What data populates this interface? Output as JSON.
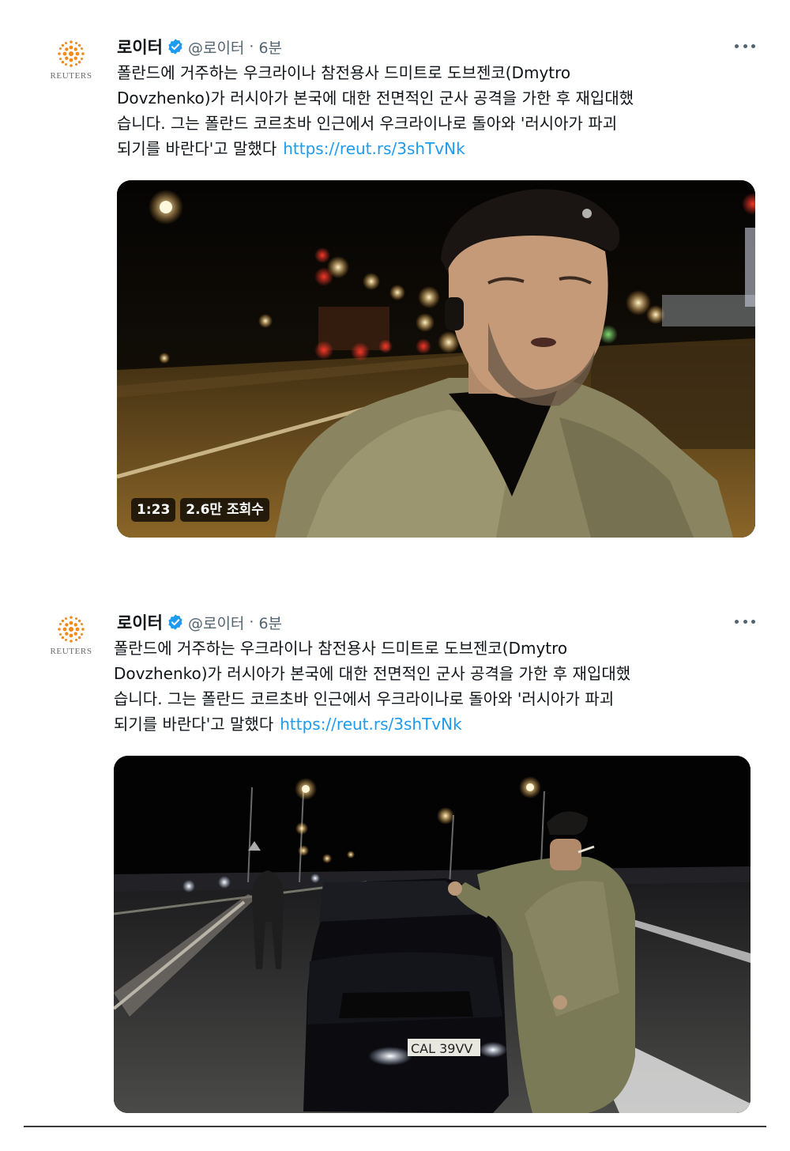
{
  "brand_color": "#ff8000",
  "link_color": "#1d9bf0",
  "tweets": [
    {
      "author": {
        "name": "로이터",
        "handle": "@로이터",
        "verified": true,
        "logo_text": "REUTERS"
      },
      "separator": "·",
      "time": "6분",
      "more_icon": "ellipsis-icon",
      "text": "폴란드에 거주하는 우크라이나 참전용사 드미트로 도브젠코(Dmytro\nDovzhenko)가 러시아가 본국에 대한 전면적인 군사 공격을 가한 후 재입대했\n습니다. 그는 폴란드 코르초바 인근에서 우크라이나로 돌아와 '러시아가 파괴\n되기를 바란다'고 말했다",
      "link": "https://reut.rs/3shTvNk",
      "media": {
        "kind": "video",
        "duration": "1:23",
        "views": "2.6만 조회수"
      }
    },
    {
      "author": {
        "name": "로이터",
        "handle": "@로이터",
        "verified": true,
        "logo_text": "REUTERS"
      },
      "separator": "·",
      "time": "6분",
      "more_icon": "ellipsis-icon",
      "text": "폴란드에 거주하는 우크라이나 참전용사 드미트로 도브젠코(Dmytro\nDovzhenko)가 러시아가 본국에 대한 전면적인 군사 공격을 가한 후 재입대했\n습니다. 그는 폴란드 코르초바 인근에서 우크라이나로 돌아와 '러시아가 파괴\n되기를 바란다'고 말했다",
      "link": "https://reut.rs/3shTvNk",
      "media": {
        "kind": "image",
        "plate_text": "CAL 39VV"
      }
    }
  ]
}
